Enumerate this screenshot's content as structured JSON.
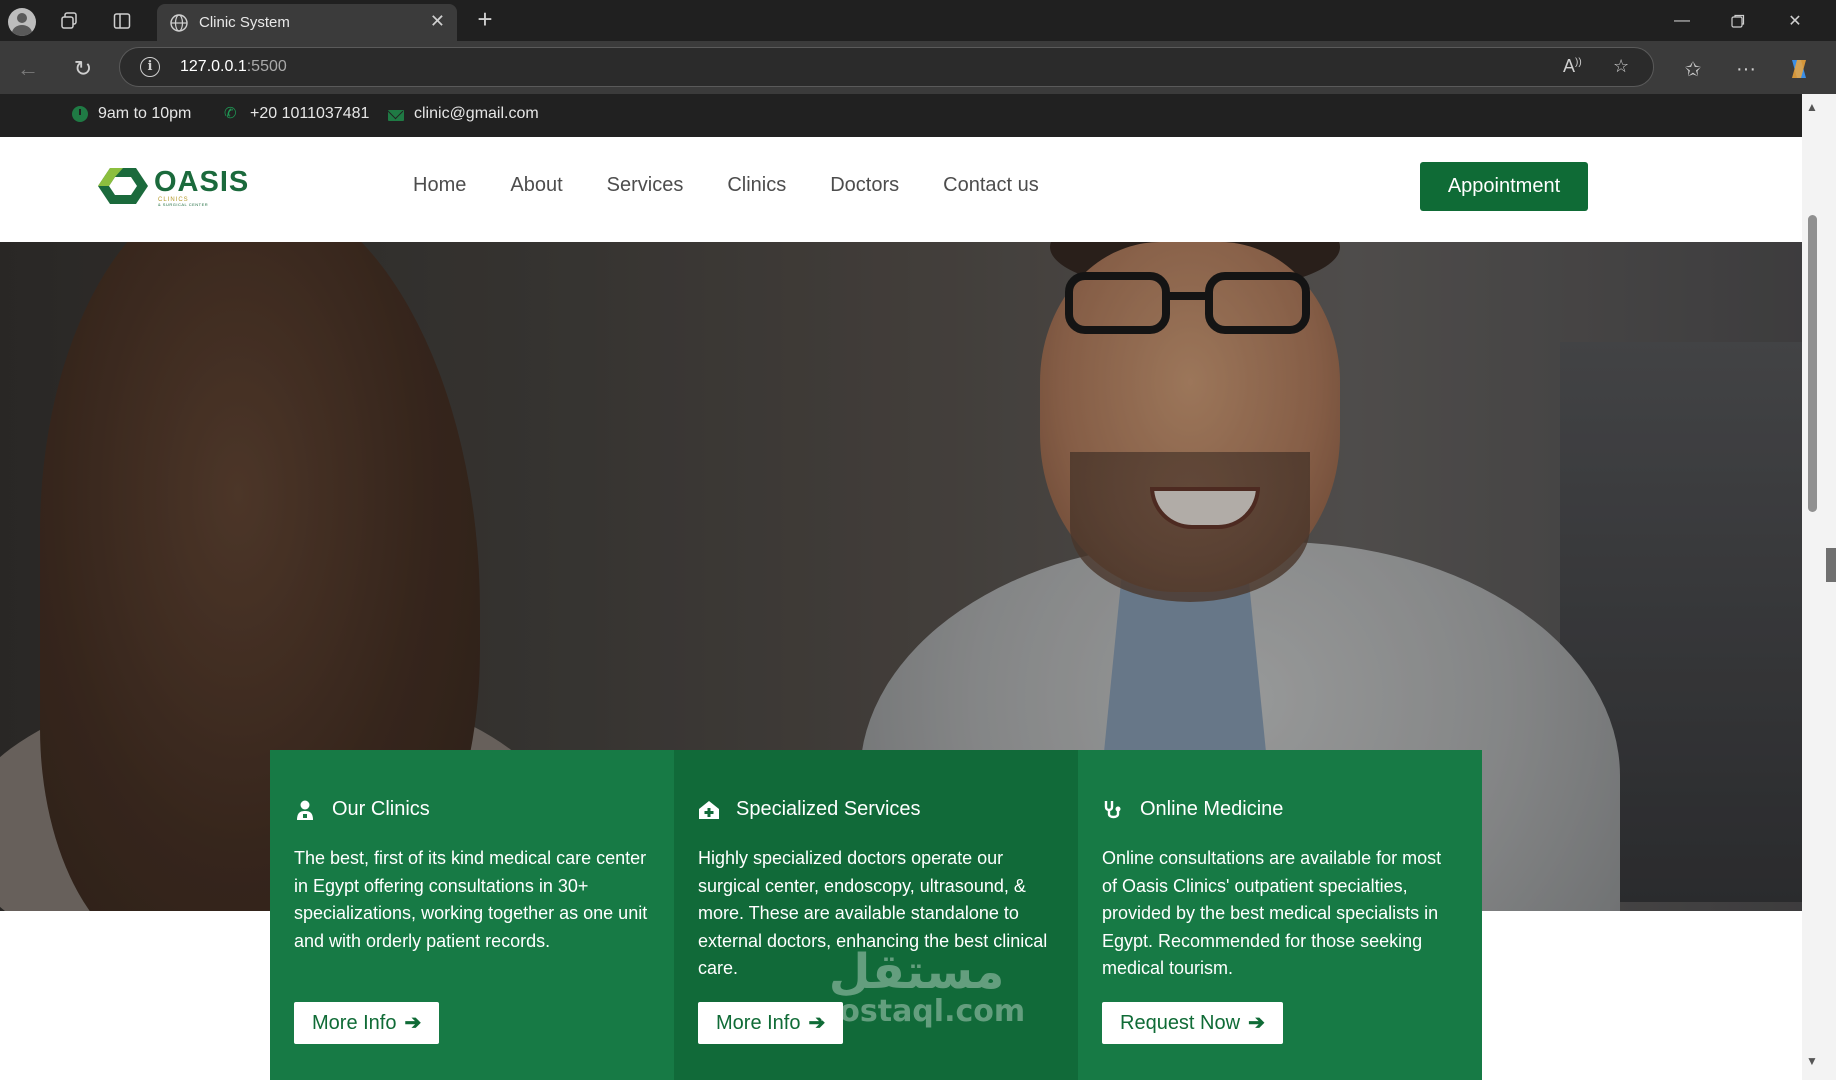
{
  "browser": {
    "tab_title": "Clinic System",
    "url_host": "127.0.0.1",
    "url_port": ":5500"
  },
  "topbar": {
    "hours": "9am to 10pm",
    "phone": "+20 1011037481",
    "email": "clinic@gmail.com"
  },
  "brand": {
    "name": "OASIS",
    "tagline": "CLINICS",
    "sub": "& SURGICAL CENTER",
    "color": "#0f6b36"
  },
  "nav": {
    "links": [
      "Home",
      "About",
      "Services",
      "Clinics",
      "Doctors",
      "Contact us"
    ],
    "cta": "Appointment"
  },
  "cards": [
    {
      "icon": "user-doctor-icon",
      "title": "Our Clinics",
      "text": "The best, first of its kind medical care center in Egypt offering consultations in 30+ specializations, working together as one unit and with orderly patient records.",
      "button": "More Info"
    },
    {
      "icon": "house-medical-icon",
      "title": "Specialized Services",
      "text": "Highly specialized doctors operate our surgical center, endoscopy, ultrasound, & more. These are available standalone to external doctors, enhancing the best clinical care.",
      "button": "More Info"
    },
    {
      "icon": "stethoscope-icon",
      "title": "Online Medicine",
      "text": "Online consultations are available for most of Oasis Clinics' outpatient specialties, provided by the best medical specialists in Egypt. Recommended for those seeking medical tourism.",
      "button": "Request Now"
    }
  ],
  "watermark": {
    "arabic": "مستقل",
    "latin": "mostaql.com"
  }
}
